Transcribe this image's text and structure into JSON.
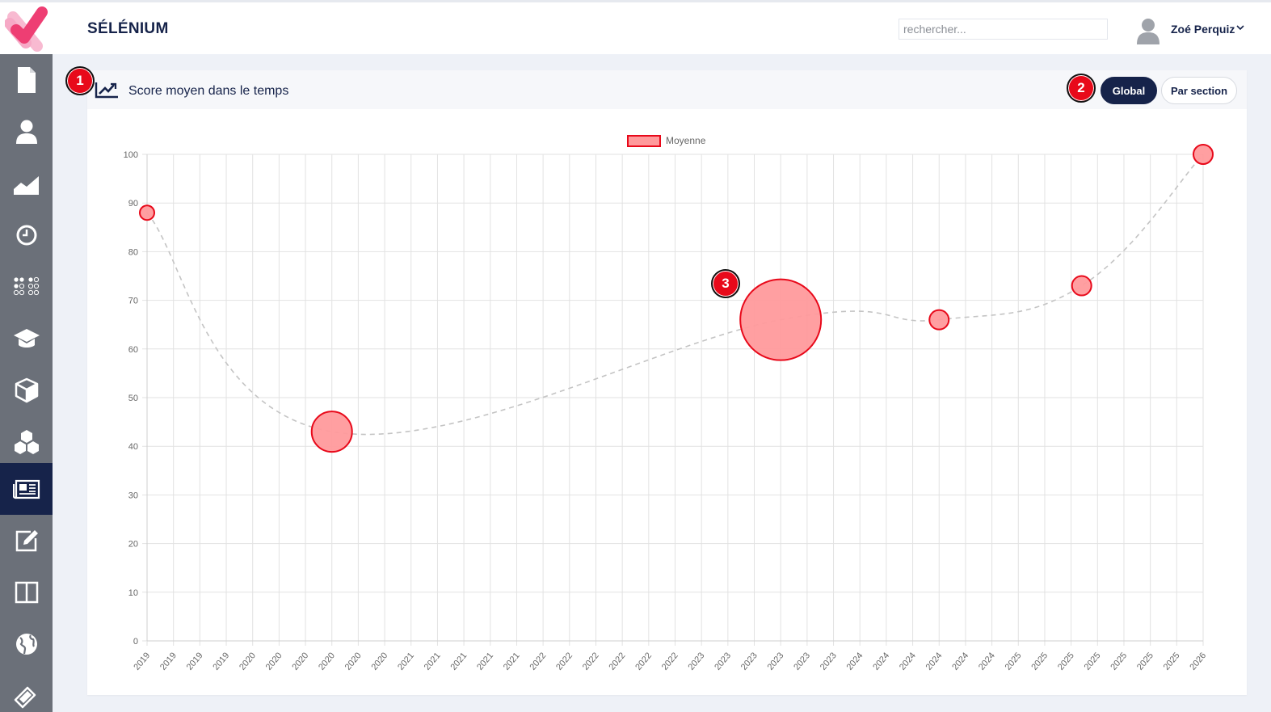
{
  "app": {
    "title": "SÉLÉNIUM",
    "search_placeholder": "rechercher...",
    "user_name": "Zoé Perquiz"
  },
  "sidebar": {
    "active_index": 8,
    "items": [
      {
        "icon": "document-icon"
      },
      {
        "icon": "user-icon"
      },
      {
        "icon": "area-chart-icon"
      },
      {
        "icon": "clock-icon"
      },
      {
        "icon": "dots-grid-icon"
      },
      {
        "icon": "graduation-cap-icon"
      },
      {
        "icon": "cube-icon"
      },
      {
        "icon": "cubes-icon"
      },
      {
        "icon": "newspaper-icon"
      },
      {
        "icon": "edit-icon"
      },
      {
        "icon": "columns-icon"
      },
      {
        "icon": "globe-icon"
      },
      {
        "icon": "ticket-icon"
      }
    ]
  },
  "card": {
    "title": "Score moyen dans le temps",
    "buttons": {
      "global": "Global",
      "par_section": "Par section"
    },
    "active_mode": "Global"
  },
  "annotations": [
    "1",
    "2",
    "3"
  ],
  "colors": {
    "navy": "#16234a",
    "bubble_fill": "#ff9a9c",
    "bubble_stroke": "#e8091a",
    "badge": "#e8091a"
  },
  "chart_data": {
    "type": "scatter",
    "legend": {
      "label": "Moyenne",
      "position": "top-center"
    },
    "x_tick_labels": [
      "2019",
      "2019",
      "2019",
      "2019",
      "2020",
      "2020",
      "2020",
      "2020",
      "2020",
      "2020",
      "2021",
      "2021",
      "2021",
      "2021",
      "2021",
      "2022",
      "2022",
      "2022",
      "2022",
      "2022",
      "2022",
      "2023",
      "2023",
      "2023",
      "2023",
      "2023",
      "2023",
      "2024",
      "2024",
      "2024",
      "2024",
      "2024",
      "2024",
      "2025",
      "2025",
      "2025",
      "2025",
      "2025",
      "2025",
      "2025",
      "2026"
    ],
    "ylim": [
      0,
      100
    ],
    "y_ticks": [
      0,
      10,
      20,
      30,
      40,
      50,
      60,
      70,
      80,
      90,
      100
    ],
    "grid": true,
    "trend_line": "dashed-smooth",
    "points": [
      {
        "x": 0,
        "y": 88,
        "r": 9
      },
      {
        "x": 7,
        "y": 43,
        "r": 25
      },
      {
        "x": 24,
        "y": 66,
        "r": 50
      },
      {
        "x": 30,
        "y": 66,
        "r": 12
      },
      {
        "x": 35.4,
        "y": 73,
        "r": 12
      },
      {
        "x": 40,
        "y": 100,
        "r": 12
      }
    ]
  }
}
